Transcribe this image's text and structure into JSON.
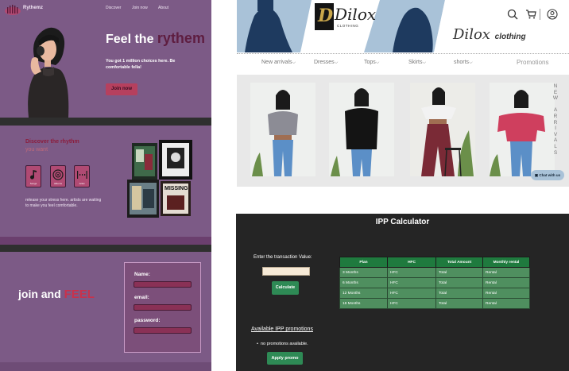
{
  "rythemz": {
    "brand": "Rythemz",
    "nav": [
      "Discover",
      "Join now",
      "About"
    ],
    "hero_title_pre": "Feel the",
    "hero_title_highlight": "rythem",
    "hero_subtitle": "You got 1 million choices here. Be comfortable fella!",
    "join_button": "Join now",
    "discover_line1": "Discover the rhythm",
    "discover_line2": "you want",
    "tiles": [
      "Songs",
      "Albums",
      "Artist"
    ],
    "release_text": "release your stress here. artists are waiting to make you feel comfortable.",
    "collage_text": "MISSING",
    "join_pre": "join and",
    "join_highlight": "FEEL",
    "form": {
      "name_label": "Name:",
      "email_label": "email:",
      "password_label": "password:"
    },
    "colors": {
      "bg": "#7c5a86",
      "accent": "#b6405e",
      "dark": "#2f2f2f"
    }
  },
  "dilox": {
    "logo_letter": "D",
    "logo_word": "Dilox",
    "logo_sub": "CLOTHING",
    "script_name": "Dilox",
    "script_tag": "clothing",
    "icons": [
      "search-icon",
      "cart-icon",
      "user-icon"
    ],
    "menu": [
      "New arrivals",
      "Dresses",
      "Tops",
      "Skirts",
      "shorts"
    ],
    "promotions": "Promotions",
    "vertical_text": [
      "N",
      "E",
      "W",
      "",
      "A",
      "R",
      "R",
      "I",
      "V",
      "A",
      "L",
      "S"
    ],
    "chat": "Chat with us",
    "colors": {
      "banner_blue": "#a9c2d8",
      "dress_navy": "#1e3a5f",
      "gallery_bg": "#e8e8e8"
    }
  },
  "ipp": {
    "title": "IPP Calculator",
    "input_label": "Enter the transaction Value:",
    "calc_button": "Calculate",
    "headers": [
      "Plan",
      "HFC",
      "Total Amount",
      "Monthly rental"
    ],
    "rows": [
      [
        "3 Months",
        "HFC",
        "Total",
        "Rental"
      ],
      [
        "6 Months",
        "HFC",
        "Total",
        "Rental"
      ],
      [
        "12 Months",
        "HFC",
        "Total",
        "Rental"
      ],
      [
        "18 Months",
        "HFC",
        "Total",
        "Rental"
      ]
    ],
    "promo_link": "Available IPP promotions",
    "promo_bullet": "no promotions available.",
    "apply_button": "Apply promo",
    "colors": {
      "bg": "#252525",
      "header": "#1f7a3e",
      "cell": "#4f8f5f",
      "button": "#2e8a55"
    }
  }
}
